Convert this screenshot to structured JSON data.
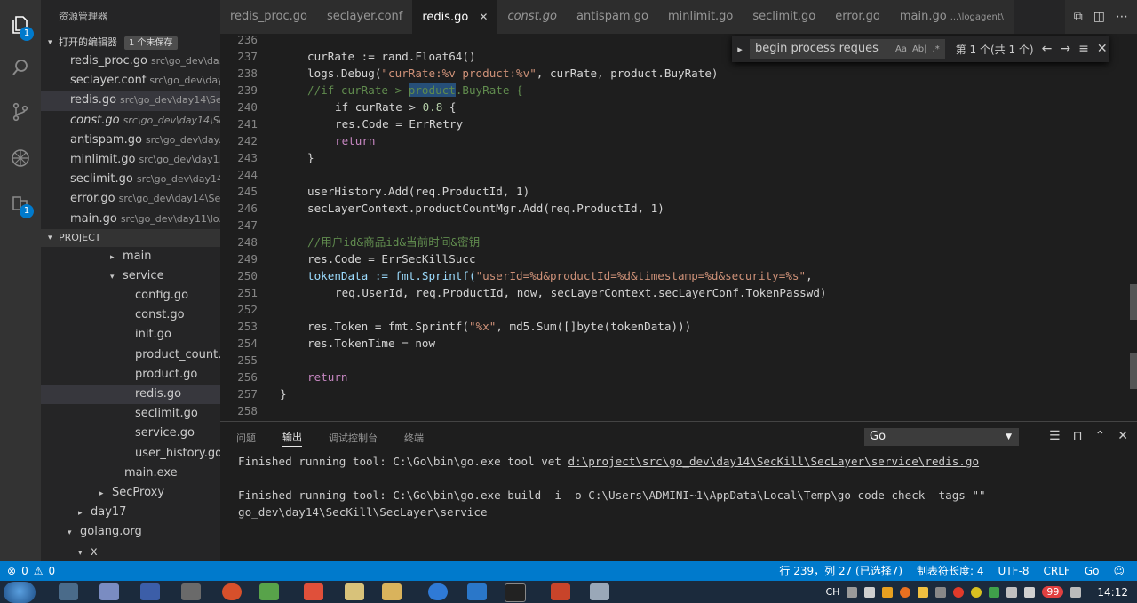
{
  "activity_bar": {
    "explorer_badge": "1",
    "extensions_badge": "1"
  },
  "sidebar": {
    "title": "资源管理器",
    "open_editors_label": "打开的编辑器",
    "unsaved_badge": "1 个未保存",
    "open_editors": [
      {
        "name": "redis_proc.go",
        "path": "src\\go_dev\\da..."
      },
      {
        "name": "seclayer.conf",
        "path": "src\\go_dev\\day..."
      },
      {
        "name": "redis.go",
        "path": "src\\go_dev\\day14\\Se..."
      },
      {
        "name": "const.go",
        "path": "src\\go_dev\\day14\\Se..."
      },
      {
        "name": "antispam.go",
        "path": "src\\go_dev\\day..."
      },
      {
        "name": "minlimit.go",
        "path": "src\\go_dev\\day1..."
      },
      {
        "name": "seclimit.go",
        "path": "src\\go_dev\\day14..."
      },
      {
        "name": "error.go",
        "path": "src\\go_dev\\day14\\Se..."
      },
      {
        "name": "main.go",
        "path": "src\\go_dev\\day11\\lo..."
      }
    ],
    "project_label": "PROJECT",
    "tree": [
      {
        "label": "main",
        "twisty": "▸"
      },
      {
        "label": "service",
        "twisty": "▾"
      },
      {
        "label": "config.go",
        "twisty": ""
      },
      {
        "label": "const.go",
        "twisty": ""
      },
      {
        "label": "init.go",
        "twisty": ""
      },
      {
        "label": "product_count...",
        "twisty": ""
      },
      {
        "label": "product.go",
        "twisty": ""
      },
      {
        "label": "redis.go",
        "twisty": ""
      },
      {
        "label": "seclimit.go",
        "twisty": ""
      },
      {
        "label": "service.go",
        "twisty": ""
      },
      {
        "label": "user_history.go",
        "twisty": ""
      },
      {
        "label": "main.exe",
        "twisty": ""
      },
      {
        "label": "SecProxy",
        "twisty": "▸"
      },
      {
        "label": "day17",
        "twisty": "▸"
      },
      {
        "label": "golang.org",
        "twisty": "▾"
      },
      {
        "label": "x",
        "twisty": "▾"
      }
    ]
  },
  "tabs": [
    {
      "label": "redis_proc.go"
    },
    {
      "label": "seclayer.conf"
    },
    {
      "label": "redis.go"
    },
    {
      "label": "const.go"
    },
    {
      "label": "antispam.go"
    },
    {
      "label": "minlimit.go"
    },
    {
      "label": "seclimit.go"
    },
    {
      "label": "error.go"
    },
    {
      "label": "main.go",
      "suffix": "...\\logagent\\"
    }
  ],
  "find_widget": {
    "query": "begin process reques",
    "case_label": "Aa",
    "word_label": "Ab|",
    "regex_label": ".*",
    "count": "第 1 个(共 1 个)"
  },
  "code": {
    "line_numbers": [
      "236",
      "237",
      "238",
      "239",
      "240",
      "241",
      "242",
      "243",
      "244",
      "245",
      "246",
      "247",
      "248",
      "249",
      "250",
      "251",
      "252",
      "253",
      "254",
      "255",
      "256",
      "257",
      "258"
    ],
    "l237": "curRate := rand.Float64()",
    "l238_a": "logs.Debug(",
    "l238_s": "\"curRate:%v product:%v\"",
    "l238_b": ", curRate, product.BuyRate)",
    "l239_a": "//if curRate > ",
    "l239_hl": "product",
    "l239_b": ".BuyRate {",
    "l240_a": "if curRate > ",
    "l240_n": "0.8",
    "l240_b": " {",
    "l241": "res.Code = ErrRetry",
    "l242": "return",
    "l243": "}",
    "l245": "userHistory.Add(req.ProductId, 1)",
    "l246": "secLayerContext.productCountMgr.Add(req.ProductId, 1)",
    "l248": "//用户id&商品id&当前时间&密钥",
    "l249": "res.Code = ErrSecKillSucc",
    "l250_a": "tokenData := fmt.Sprintf(",
    "l250_s": "\"userId=%d&productId=%d&timestamp=%d&security=%s\"",
    "l250_b": ",",
    "l251": "req.UserId, req.ProductId, now, secLayerContext.secLayerConf.TokenPasswd)",
    "l253_a": "res.Token = fmt.Sprintf(",
    "l253_s": "\"%x\"",
    "l253_b": ", md5.Sum([]byte(tokenData)))",
    "l254": "res.TokenTime = now",
    "l256": "return",
    "l257": "}"
  },
  "panel": {
    "tabs": [
      "问题",
      "输出",
      "调试控制台",
      "终端"
    ],
    "select_value": "Go",
    "output": {
      "line1_prefix": "Finished running tool: C:\\Go\\bin\\go.exe tool vet ",
      "line1_link": "d:\\project\\src\\go_dev\\day14\\SecKill\\SecLayer\\service\\redis.go",
      "line2": "Finished running tool: C:\\Go\\bin\\go.exe build -i -o C:\\Users\\ADMINI~1\\AppData\\Local\\Temp\\go-code-check -tags \"\"",
      "line3": "go_dev\\day14\\SecKill\\SecLayer\\service"
    }
  },
  "status_bar": {
    "errors": "0",
    "warnings": "0",
    "position": "行 239，列 27 (已选择7)",
    "tab_size": "制表符长度: 4",
    "encoding": "UTF-8",
    "eol": "CRLF",
    "language": "Go"
  },
  "taskbar": {
    "ime": "CH",
    "tray_badge": "99",
    "clock": "14:12"
  }
}
